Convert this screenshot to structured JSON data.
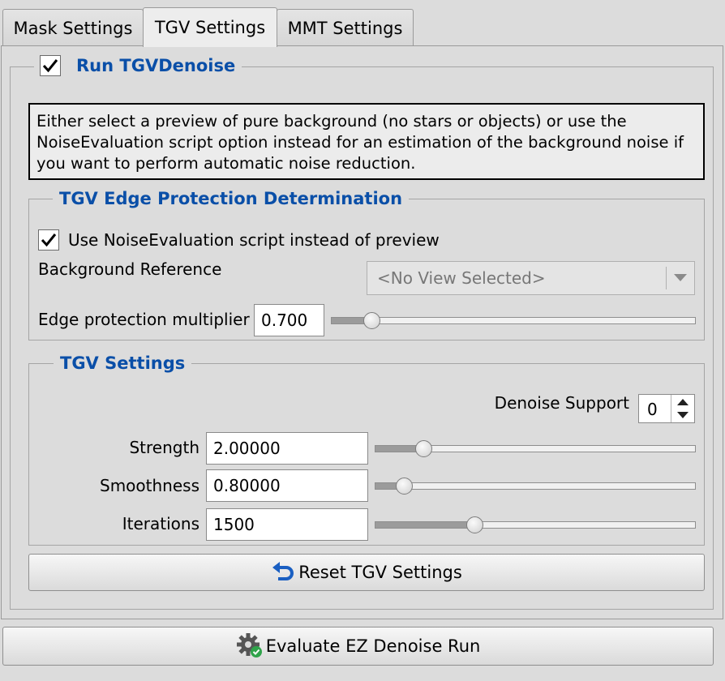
{
  "tabs": [
    {
      "label": "Mask Settings",
      "active": false
    },
    {
      "label": "TGV Settings",
      "active": true
    },
    {
      "label": "MMT Settings",
      "active": false
    }
  ],
  "run_group": {
    "label": "Run TGVDenoise",
    "checked": true,
    "info_text": "Either select a preview of pure background (no stars or objects) or use the NoiseEvaluation script option instead for an estimation of the background noise if you want to perform automatic noise reduction."
  },
  "edge_group": {
    "title": "TGV Edge Protection Determination",
    "use_noise_eval_label": "Use NoiseEvaluation script instead of preview",
    "use_noise_eval_checked": true,
    "background_reference_label": "Background Reference",
    "background_reference_value": "<No View Selected>",
    "edge_multiplier_label": "Edge protection multiplier",
    "edge_multiplier_value": "0.700",
    "edge_multiplier_slider_fraction": 0.11
  },
  "tgv_group": {
    "title": "TGV Settings",
    "denoise_support_label": "Denoise Support",
    "denoise_support_value": "0",
    "strength_label": "Strength",
    "strength_value": "2.00000",
    "strength_slider_fraction": 0.15,
    "smoothness_label": "Smoothness",
    "smoothness_value": "0.80000",
    "smoothness_slider_fraction": 0.09,
    "iterations_label": "Iterations",
    "iterations_value": "1500",
    "iterations_slider_fraction": 0.31
  },
  "reset_button_label": "Reset TGV Settings",
  "evaluate_button_label": "Evaluate EZ Denoise Run",
  "colors": {
    "group_title": "#0a4fa8",
    "reset_icon": "#1a5fc2",
    "check_badge": "#2fa34a"
  }
}
